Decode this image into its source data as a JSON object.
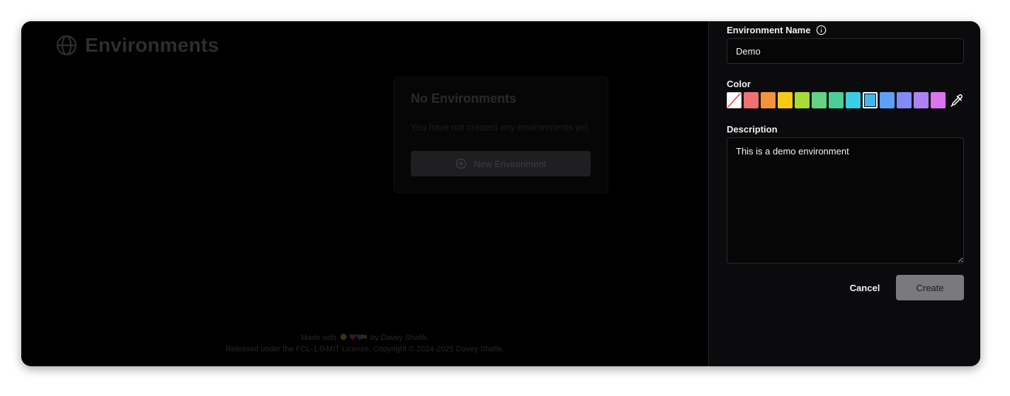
{
  "page": {
    "title": "Environments",
    "empty_state": {
      "title": "No Environments",
      "description": "You have not created any environments yet.",
      "button_label": "New Environment"
    },
    "footer": {
      "line1_prefix": "Made with",
      "line1_suffix": "by Davey Shafik.",
      "line2": "Released under the FCL-1.0-MIT License. Copyright © 2024-2025 Davey Shafik."
    }
  },
  "drawer": {
    "name_label": "Environment Name",
    "name_value": "Demo",
    "color_label": "Color",
    "colors": [
      {
        "name": "none",
        "hex": "#ffffff"
      },
      {
        "name": "red",
        "hex": "#f07171"
      },
      {
        "name": "orange",
        "hex": "#f5923e"
      },
      {
        "name": "yellow",
        "hex": "#f8c916"
      },
      {
        "name": "lime",
        "hex": "#a6dc36"
      },
      {
        "name": "green",
        "hex": "#63d382"
      },
      {
        "name": "emerald",
        "hex": "#4bcf96"
      },
      {
        "name": "cyan",
        "hex": "#3ccde6"
      },
      {
        "name": "sky",
        "hex": "#44b6ee"
      },
      {
        "name": "blue",
        "hex": "#5ea0f7"
      },
      {
        "name": "indigo",
        "hex": "#8389f5"
      },
      {
        "name": "violet",
        "hex": "#ac82f4"
      },
      {
        "name": "fuchsia",
        "hex": "#dc74ef"
      }
    ],
    "selected_color": "sky",
    "description_label": "Description",
    "description_value": "This is a demo environment",
    "cancel_label": "Cancel",
    "create_label": "Create"
  }
}
